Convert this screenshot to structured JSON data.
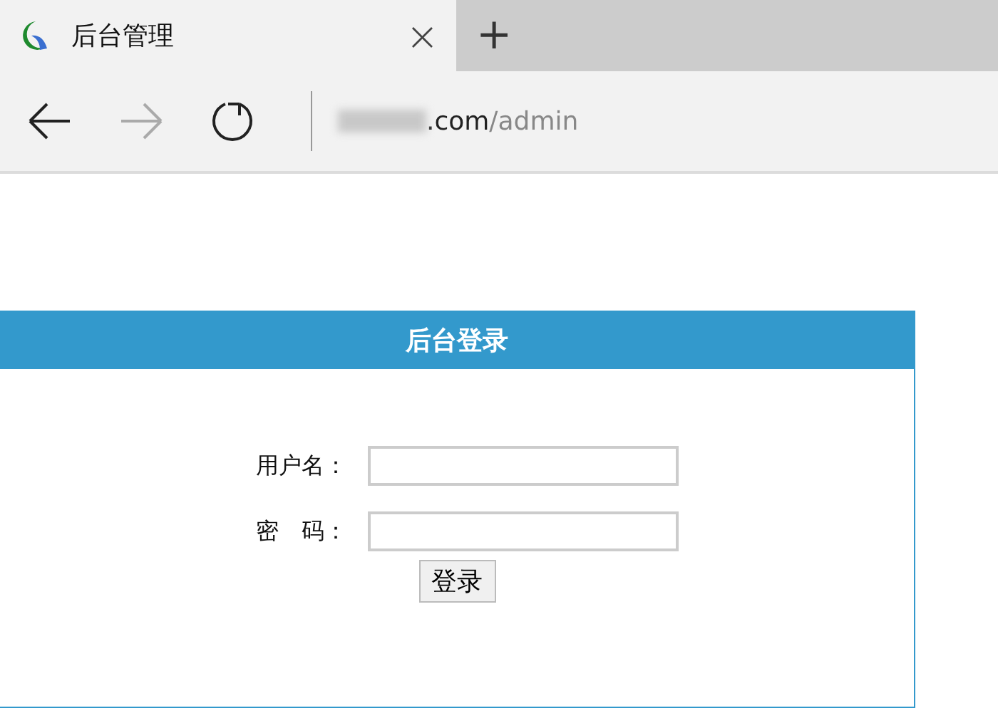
{
  "tab": {
    "title": "后台管理",
    "close": "×",
    "new_tab": "+"
  },
  "address": {
    "host": ".com",
    "path": "/admin"
  },
  "login": {
    "title": "后台登录",
    "fields": [
      {
        "label": "用户名："
      },
      {
        "label": "密　码："
      }
    ],
    "button": "登录"
  }
}
